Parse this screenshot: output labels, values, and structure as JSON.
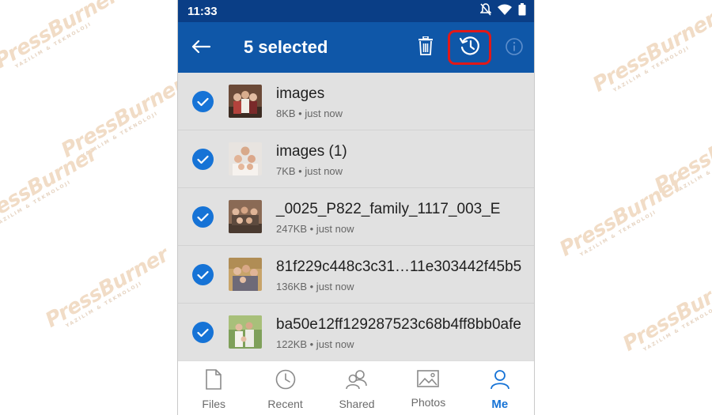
{
  "watermark": {
    "brand": "PressBurner",
    "tagline": "YAZILIM & TEKNOLOJI"
  },
  "status_bar": {
    "time": "11:33",
    "icons": [
      "notifications-off-icon",
      "wifi-icon",
      "battery-icon"
    ]
  },
  "app_bar": {
    "title": "5 selected",
    "actions": [
      "back-arrow-icon",
      "delete-icon",
      "restore-history-icon",
      "info-icon"
    ],
    "highlight_color": "#e11818",
    "background_color": "#0f57a8"
  },
  "files": [
    {
      "name": "images",
      "meta": "8KB • just now",
      "selected": true
    },
    {
      "name": "images (1)",
      "meta": "7KB • just now",
      "selected": true
    },
    {
      "name": "_0025_P822_family_1117_003_E",
      "meta": "247KB • just now",
      "selected": true
    },
    {
      "name": "81f229c448c3c31…11e303442f45b5",
      "meta": "136KB • just now",
      "selected": true
    },
    {
      "name": "ba50e12ff129287523c68b4ff8bb0afe",
      "meta": "122KB • just now",
      "selected": true
    }
  ],
  "bottom_nav": [
    {
      "label": "Files",
      "icon": "file-icon",
      "active": false
    },
    {
      "label": "Recent",
      "icon": "clock-icon",
      "active": false
    },
    {
      "label": "Shared",
      "icon": "people-icon",
      "active": false
    },
    {
      "label": "Photos",
      "icon": "image-icon",
      "active": false
    },
    {
      "label": "Me",
      "icon": "person-icon",
      "active": true
    }
  ],
  "accent_color": "#1673d6"
}
